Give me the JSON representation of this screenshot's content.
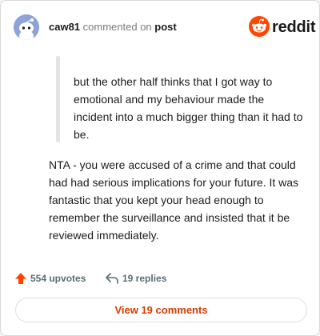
{
  "colors": {
    "accent": "#d93a00",
    "reddit_orange": "#ff4500",
    "upvote": "#ff4500",
    "avatar_bg": "#8fa3d8",
    "muted": "#576f76"
  },
  "header": {
    "username": "caw81",
    "verb": "commented on",
    "post_link": "post",
    "brand": "reddit",
    "avatar_icon": "snoo-avatar-icon",
    "brand_icon": "reddit-logo-icon"
  },
  "comment": {
    "quote": "but the other half thinks that I got way to emotional and my behaviour made the incident into a much bigger thing than it had to be.",
    "body": "NTA - you were accused of a crime and that could had had serious implications for your future. It was fantastic that you kept your head enough to remember the surveillance and insisted that it be reviewed immediately."
  },
  "footer": {
    "upvotes_label": "554 upvotes",
    "replies_label": "19 replies",
    "upvote_icon": "upvote-arrow-icon",
    "reply_icon": "reply-arrow-icon",
    "view_button": "View 19 comments"
  }
}
